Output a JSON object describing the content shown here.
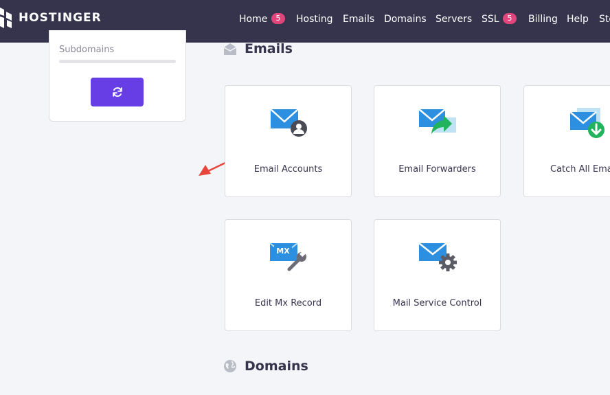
{
  "header": {
    "brand": "HOSTINGER",
    "nav": [
      {
        "label": "Home",
        "badge": "5"
      },
      {
        "label": "Hosting"
      },
      {
        "label": "Emails"
      },
      {
        "label": "Domains"
      },
      {
        "label": "Servers"
      },
      {
        "label": "SSL",
        "badge": "5"
      },
      {
        "label": "Billing"
      },
      {
        "label": "Help"
      },
      {
        "label": "Store"
      }
    ]
  },
  "sidebar": {
    "subdomains_label": "Subdomains",
    "refresh_icon": "refresh-icon"
  },
  "emails_section": {
    "title": "Emails",
    "icon": "envelope-icon",
    "tiles": [
      {
        "label": "Email Accounts",
        "icon": "email-accounts-icon"
      },
      {
        "label": "Email Forwarders",
        "icon": "email-forwarders-icon"
      },
      {
        "label": "Catch All Emails",
        "icon": "catch-all-emails-icon"
      },
      {
        "label": "Edit Mx Record",
        "icon": "edit-mx-record-icon"
      },
      {
        "label": "Mail Service Control",
        "icon": "mail-service-control-icon"
      }
    ]
  },
  "domains_section": {
    "title": "Domains",
    "icon": "globe-icon"
  },
  "colors": {
    "nav_bg": "#36344d",
    "accent": "#673de6",
    "badge": "#e0467c",
    "annotation_arrow": "#e8463c"
  }
}
